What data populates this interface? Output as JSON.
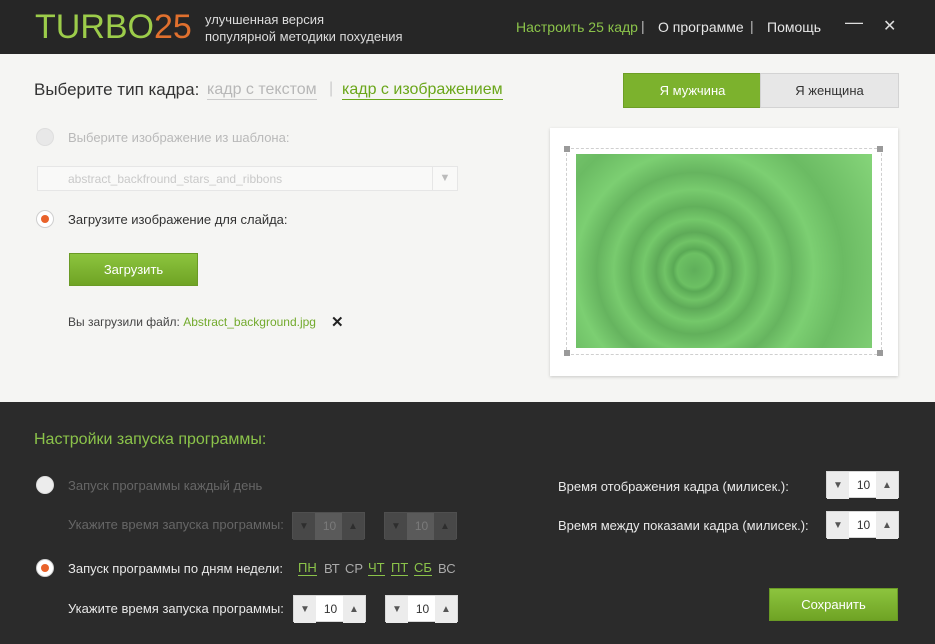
{
  "header": {
    "logo_turbo": "TURBO",
    "logo_num": "25",
    "tagline_1": "улучшенная версия",
    "tagline_2": "популярной методики похудения",
    "nav_configure": "Настроить 25 кадр",
    "nav_about": "О программе",
    "nav_help": "Помощь",
    "minimize": "—",
    "close": "✕"
  },
  "frame_type": {
    "label": "Выберите тип кадра:",
    "option_text": "кадр с текстом",
    "option_image": "кадр с изображением"
  },
  "gender": {
    "male": "Я мужчина",
    "female": "Я женщина",
    "selected": "male"
  },
  "image_source": {
    "template_label": "Выберите изображение из шаблона:",
    "template_value": "abstract_backfround_stars_and_ribbons",
    "upload_label": "Загрузите изображение для слайда:",
    "upload_button": "Загрузить",
    "uploaded_prefix": "Вы загрузили файл:",
    "uploaded_file": "Abstract_background.jpg"
  },
  "launch": {
    "title": "Настройки запуска программы:",
    "daily_label": "Запуск программы каждый день",
    "time_label": "Укажите время запуска программы:",
    "weekly_label": "Запуск программы по дням недели:",
    "time_label_2": "Укажите время запуска программы:",
    "days": [
      {
        "label": "ПН",
        "on": true
      },
      {
        "label": "ВТ",
        "on": false
      },
      {
        "label": "СР",
        "on": false
      },
      {
        "label": "ЧТ",
        "on": true
      },
      {
        "label": "ПТ",
        "on": true
      },
      {
        "label": "СБ",
        "on": true
      },
      {
        "label": "ВС",
        "on": false
      }
    ],
    "daily_hours": "10",
    "daily_minutes": "10",
    "weekly_hours": "10",
    "weekly_minutes": "10"
  },
  "timing": {
    "display_label": "Время отображения кадра (милисек.):",
    "display_value": "10",
    "between_label": "Время между показами кадра (милисек.):",
    "between_value": "10"
  },
  "save_button": "Сохранить",
  "colors": {
    "accent": "#8bc34a",
    "radio": "#e9622a",
    "dark_bg": "#2b2b2b",
    "light_bg": "#f5f5f3"
  }
}
